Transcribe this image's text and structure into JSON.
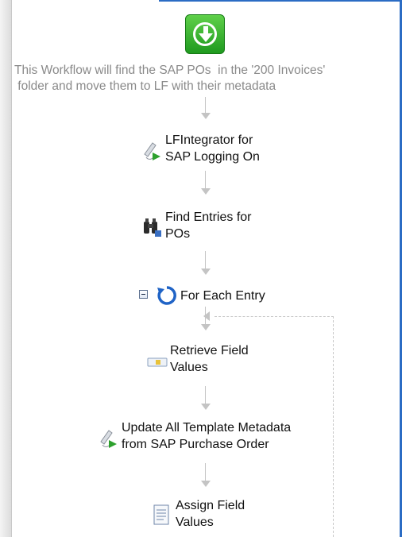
{
  "workflow": {
    "description": "This Workflow will find the SAP POs  in the '200 Invoices'\n folder and move them to LF with their metadata",
    "activities": [
      {
        "label": "LFIntegrator for\nSAP Logging On",
        "icon": "sap-connector-icon"
      },
      {
        "label": "Find Entries for\nPOs",
        "icon": "binoculars-icon"
      },
      {
        "label": "For Each Entry",
        "icon": "loop-arrow-icon"
      },
      {
        "label": "Retrieve Field\nValues",
        "icon": "field-retrieve-icon"
      },
      {
        "label": "Update All Template Metadata\nfrom SAP Purchase Order",
        "icon": "sap-connector-icon"
      },
      {
        "label": "Assign Field\nValues",
        "icon": "document-icon"
      }
    ]
  },
  "colors": {
    "start": "#27a527",
    "accent": "#2b6cc4",
    "connector": "#c4c4c4",
    "description_text": "#8a8a8a"
  }
}
